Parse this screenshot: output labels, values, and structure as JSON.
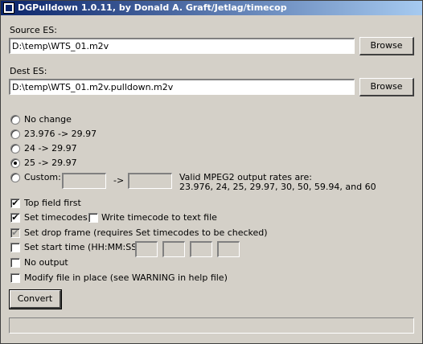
{
  "title": "DGPulldown 1.0.11, by Donald A. Graft/Jetlag/timecop",
  "source": {
    "label": "Source ES:",
    "value": "D:\\temp\\WTS_01.m2v",
    "browse": "Browse"
  },
  "dest": {
    "label": "Dest ES:",
    "value": "D:\\temp\\WTS_01.m2v.pulldown.m2v",
    "browse": "Browse"
  },
  "rates": [
    {
      "label": "No change",
      "checked": false
    },
    {
      "label": "23.976 -> 29.97",
      "checked": false
    },
    {
      "label": "24 -> 29.97",
      "checked": false
    },
    {
      "label": "25 -> 29.97",
      "checked": true
    },
    {
      "label": "Custom:",
      "checked": false
    }
  ],
  "custom": {
    "from": "",
    "arrow": "->",
    "to": "",
    "note_line1": "Valid MPEG2 output rates are:",
    "note_line2": "23.976, 24, 25, 29.97, 30, 50, 59.94, and 60"
  },
  "options": {
    "top_field_first": {
      "label": "Top field first",
      "checked": true
    },
    "set_timecodes": {
      "label": "Set timecodes",
      "checked": true
    },
    "write_timecode": {
      "label": "Write timecode to text file",
      "checked": false
    },
    "drop_frame": {
      "label": "Set drop frame (requires Set timecodes to be checked)",
      "checked": true
    },
    "start_time": {
      "label": "Set start time (HH:MM:SS:FF)",
      "checked": false,
      "hh": "",
      "mm": "",
      "ss": "",
      "ff": ""
    },
    "no_output": {
      "label": "No output",
      "checked": false
    },
    "modify_in_place": {
      "label": "Modify file in place (see WARNING in help file)",
      "checked": false
    }
  },
  "convert": "Convert",
  "progress": 0
}
